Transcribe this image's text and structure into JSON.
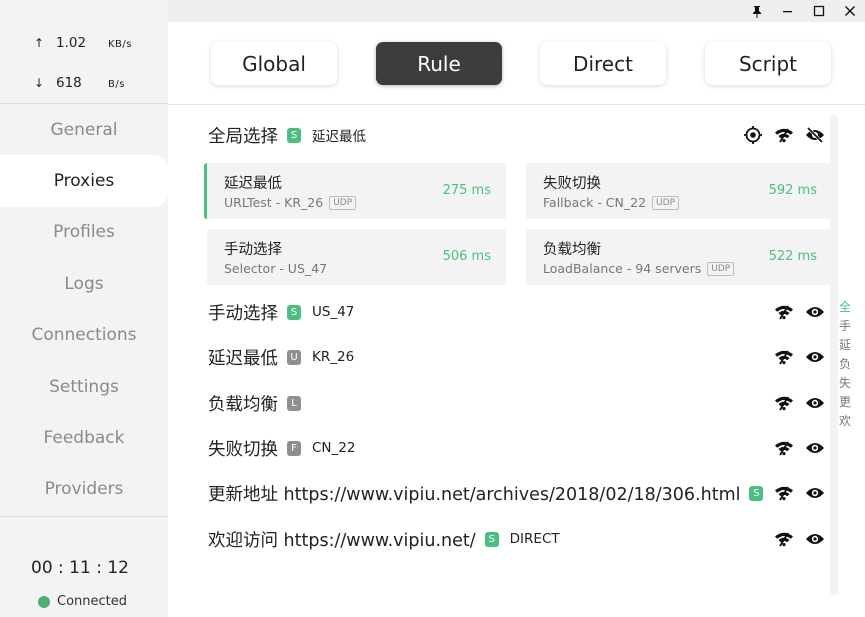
{
  "window": {
    "controls": {
      "pin": "pin-icon",
      "minimize": "minimize-icon",
      "maximize": "maximize-icon",
      "close": "close-icon"
    }
  },
  "traffic": {
    "up": {
      "arrow": "↑",
      "value": "1.02",
      "unit": "KB/s"
    },
    "down": {
      "arrow": "↓",
      "value": "618",
      "unit": "B/s"
    }
  },
  "nav": {
    "items": [
      "General",
      "Proxies",
      "Profiles",
      "Logs",
      "Connections",
      "Settings",
      "Feedback",
      "Providers"
    ],
    "active": "Proxies"
  },
  "status": {
    "timer": "00 : 11 : 12",
    "connection": "Connected",
    "connection_color": "#4caf74"
  },
  "modes": {
    "items": [
      "Global",
      "Rule",
      "Direct",
      "Script"
    ],
    "active": "Rule"
  },
  "colors": {
    "accent": "#4cbf80",
    "badge_gray": "#8f8f8f",
    "active_mode": "#3c3c3c"
  },
  "groups": [
    {
      "name": "全局选择",
      "badge": "S",
      "now": "延迟最低",
      "expanded": true,
      "icons": [
        "locate-icon",
        "wifi-icon",
        "eye-off-icon"
      ]
    },
    {
      "name": "手动选择",
      "badge": "S",
      "now": "US_47",
      "icons": [
        "wifi-icon",
        "eye-icon"
      ]
    },
    {
      "name": "延迟最低",
      "badge": "U",
      "now": "KR_26",
      "icons": [
        "wifi-icon",
        "eye-icon"
      ]
    },
    {
      "name": "负载均衡",
      "badge": "L",
      "now": "",
      "icons": [
        "wifi-icon",
        "eye-icon"
      ]
    },
    {
      "name": "失败切换",
      "badge": "F",
      "now": "CN_22",
      "icons": [
        "wifi-icon",
        "eye-icon"
      ]
    },
    {
      "name": "更新地址 https://www.vipiu.net/archives/2018/02/18/306.html",
      "badge": "S",
      "now": "",
      "icons": [
        "wifi-icon",
        "eye-icon"
      ]
    },
    {
      "name": "欢迎访问 https://www.vipiu.net/",
      "badge": "S",
      "now": "DIRECT",
      "icons": [
        "wifi-icon",
        "eye-icon"
      ]
    }
  ],
  "proxy_cards": [
    {
      "name": "延迟最低",
      "type": "URLTest - KR_26",
      "udp": "UDP",
      "delay": "275 ms",
      "selected": true
    },
    {
      "name": "失败切换",
      "type": "Fallback - CN_22",
      "udp": "UDP",
      "delay": "592 ms",
      "selected": false
    },
    {
      "name": "手动选择",
      "type": "Selector - US_47",
      "udp": "",
      "delay": "506 ms",
      "selected": false
    },
    {
      "name": "负载均衡",
      "type": "LoadBalance - 94 servers",
      "udp": "UDP",
      "delay": "522 ms",
      "selected": false
    }
  ],
  "index_bar": [
    "全",
    "手",
    "延",
    "负",
    "失",
    "更",
    "欢"
  ]
}
